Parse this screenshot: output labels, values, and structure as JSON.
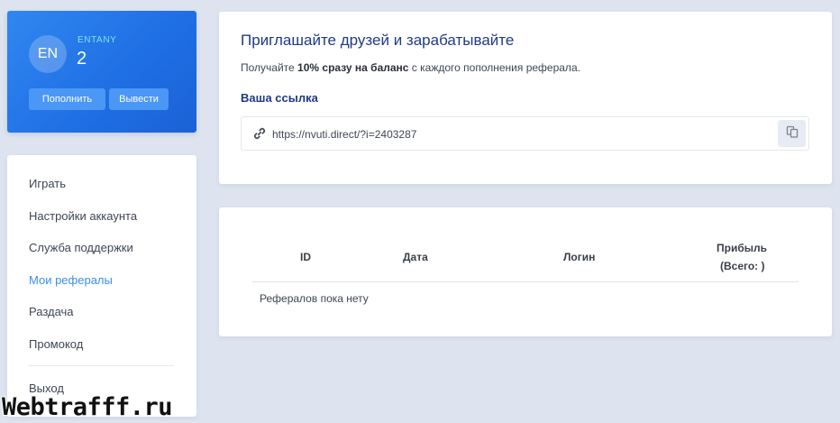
{
  "profile": {
    "initials": "EN",
    "username": "ENTANY",
    "balance": "2",
    "deposit_label": "Пополнить",
    "withdraw_label": "Вывести"
  },
  "menu": {
    "items": [
      {
        "label": "Играть",
        "active": false
      },
      {
        "label": "Настройки аккаунта",
        "active": false
      },
      {
        "label": "Служба поддержки",
        "active": false
      },
      {
        "label": "Мои рефералы",
        "active": true
      },
      {
        "label": "Раздача",
        "active": false
      },
      {
        "label": "Промокод",
        "active": false
      }
    ],
    "logout_label": "Выход"
  },
  "invite": {
    "title": "Приглашайте друзей и зарабатывайте",
    "desc_prefix": "Получайте ",
    "desc_bold": "10% сразу на баланс",
    "desc_suffix": " с каждого пополнения реферала.",
    "link_label": "Ваша ссылка",
    "link_value": "https://nvuti.direct/?i=2403287",
    "link_icon": "link-icon",
    "copy_icon": "copy-icon"
  },
  "referrals": {
    "columns": [
      "ID",
      "Дата",
      "Логин",
      "Прибыль",
      "(Всего: )"
    ],
    "empty_message": "Рефералов пока нету"
  },
  "watermark": "Webtrafff.ru",
  "colors": {
    "accent": "#1f6ee4",
    "active_menu": "#3b8ef0",
    "title": "#1f3a87",
    "background": "#dde4ef"
  }
}
